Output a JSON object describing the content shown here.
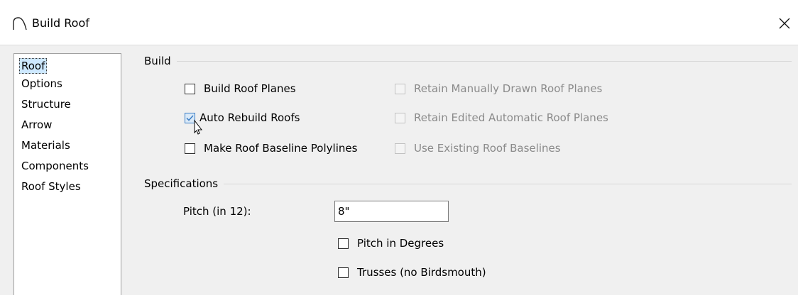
{
  "window": {
    "title": "Build Roof"
  },
  "sidebar": {
    "items": [
      {
        "label": "Roof",
        "selected": true
      },
      {
        "label": "Options"
      },
      {
        "label": "Structure"
      },
      {
        "label": "Arrow"
      },
      {
        "label": "Materials"
      },
      {
        "label": "Components"
      },
      {
        "label": "Roof Styles"
      }
    ]
  },
  "build": {
    "label": "Build",
    "checkboxes": [
      {
        "label": "Build Roof Planes",
        "checked": false,
        "enabled": true
      },
      {
        "label": "Auto Rebuild Roofs",
        "checked": true,
        "enabled": true
      },
      {
        "label": "Make Roof Baseline Polylines",
        "checked": false,
        "enabled": true
      },
      {
        "label": "Retain Manually Drawn Roof Planes",
        "checked": false,
        "enabled": false
      },
      {
        "label": "Retain Edited Automatic Roof Planes",
        "checked": false,
        "enabled": false
      },
      {
        "label": "Use Existing Roof Baselines",
        "checked": false,
        "enabled": false
      }
    ]
  },
  "specifications": {
    "label": "Specifications",
    "pitch_label": "Pitch (in 12):",
    "pitch_value": "8\"",
    "checkboxes": [
      {
        "label": "Pitch in Degrees",
        "checked": false,
        "enabled": true
      },
      {
        "label": "Trusses (no Birdsmouth)",
        "checked": false,
        "enabled": true
      }
    ]
  },
  "icons": {
    "app": "roof-arch-icon",
    "close": "close-icon",
    "cursor": "mouse-pointer-icon"
  },
  "colors": {
    "selection": "#cde8ff",
    "checkbox_checked": "#3a7cc4",
    "disabled_text": "#8a8a8a"
  }
}
